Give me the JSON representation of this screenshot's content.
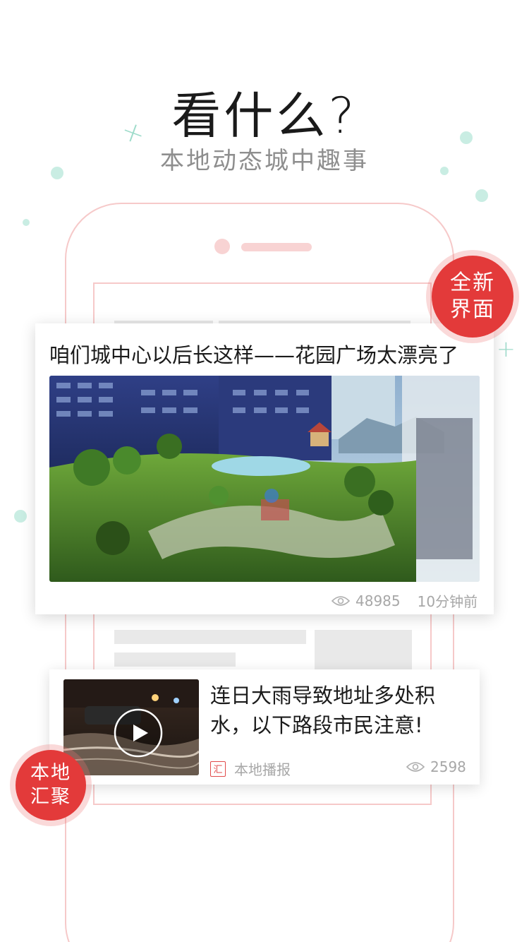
{
  "hero": {
    "headline": "看什么?",
    "subline": "本地动态城中趣事"
  },
  "badges": {
    "new_ui": [
      "全新",
      "界面"
    ],
    "local": [
      "本地",
      "汇聚"
    ]
  },
  "featured_article": {
    "title": "咱们城中心以后长这样——花园广场太漂亮了",
    "image": "garden-plaza-rendering",
    "views": "48985",
    "time": "10分钟前"
  },
  "list_article": {
    "title": "连日大雨导致地址多处积水，以下路段市民注意!",
    "thumbnail": "flooded-street-night-video",
    "source": "本地播报",
    "source_logo": "汇",
    "views": "2598"
  },
  "colors": {
    "accent": "#e33a3a",
    "phone_outline": "#f6c9c9",
    "decor": "#c9ede3"
  }
}
